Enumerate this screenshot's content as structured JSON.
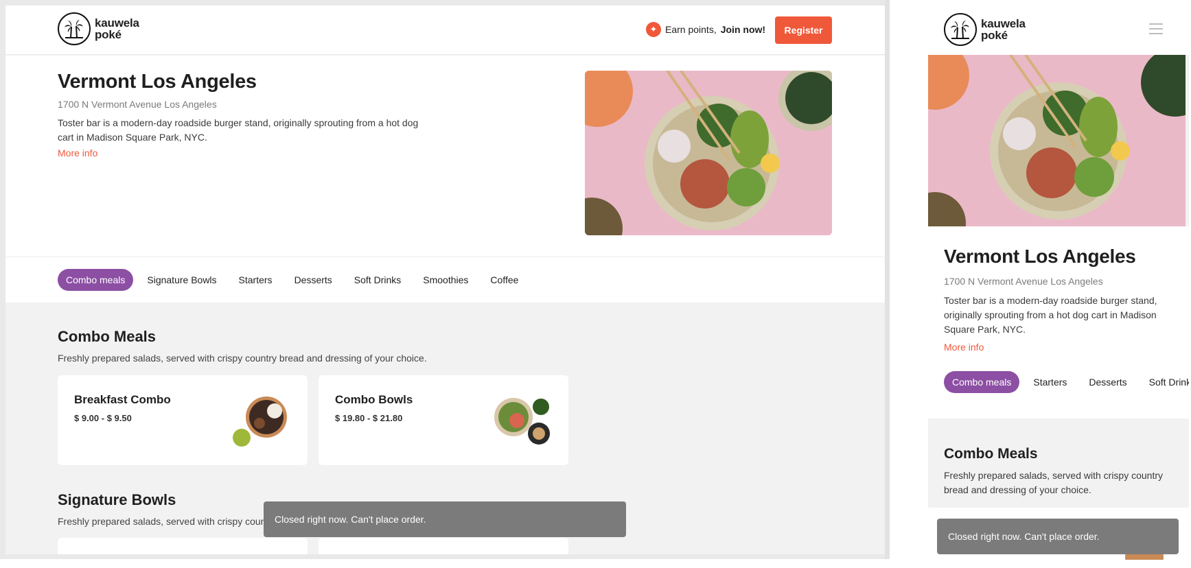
{
  "brand": {
    "line1": "kauwela",
    "line2": "poké"
  },
  "header": {
    "earn_prefix": "Earn points,",
    "earn_link": "Join now!",
    "register": "Register"
  },
  "store": {
    "name": "Vermont Los Angeles",
    "address": "1700 N Vermont Avenue Los Angeles",
    "description": "Toster bar is a modern-day roadside burger stand, originally sprouting from a hot dog cart in Madison Square Park, NYC.",
    "more_info": "More info"
  },
  "tabs": [
    {
      "label": "Combo meals",
      "active": true
    },
    {
      "label": "Signature Bowls"
    },
    {
      "label": "Starters"
    },
    {
      "label": "Desserts"
    },
    {
      "label": "Soft Drinks"
    },
    {
      "label": "Smoothies"
    },
    {
      "label": "Coffee"
    }
  ],
  "mobile_tabs": [
    "Combo meals",
    "Starters",
    "Desserts",
    "Soft Drinks"
  ],
  "sections": [
    {
      "title": "Combo Meals",
      "subtitle": "Freshly prepared salads, served with crispy country bread and dressing of your choice.",
      "items": [
        {
          "name": "Breakfast Combo",
          "price": "$ 9.00 - $ 9.50"
        },
        {
          "name": "Combo Bowls",
          "price": "$ 19.80 - $ 21.80"
        }
      ]
    },
    {
      "title": "Signature Bowls",
      "subtitle": "Freshly prepared salads, served with crispy country bread and dressing of your choice."
    }
  ],
  "toast": "Closed right now. Can't place order.",
  "colors": {
    "accent": "#f0583a",
    "active_tab": "#8c4fa3",
    "toast": "#7b7b7b"
  }
}
